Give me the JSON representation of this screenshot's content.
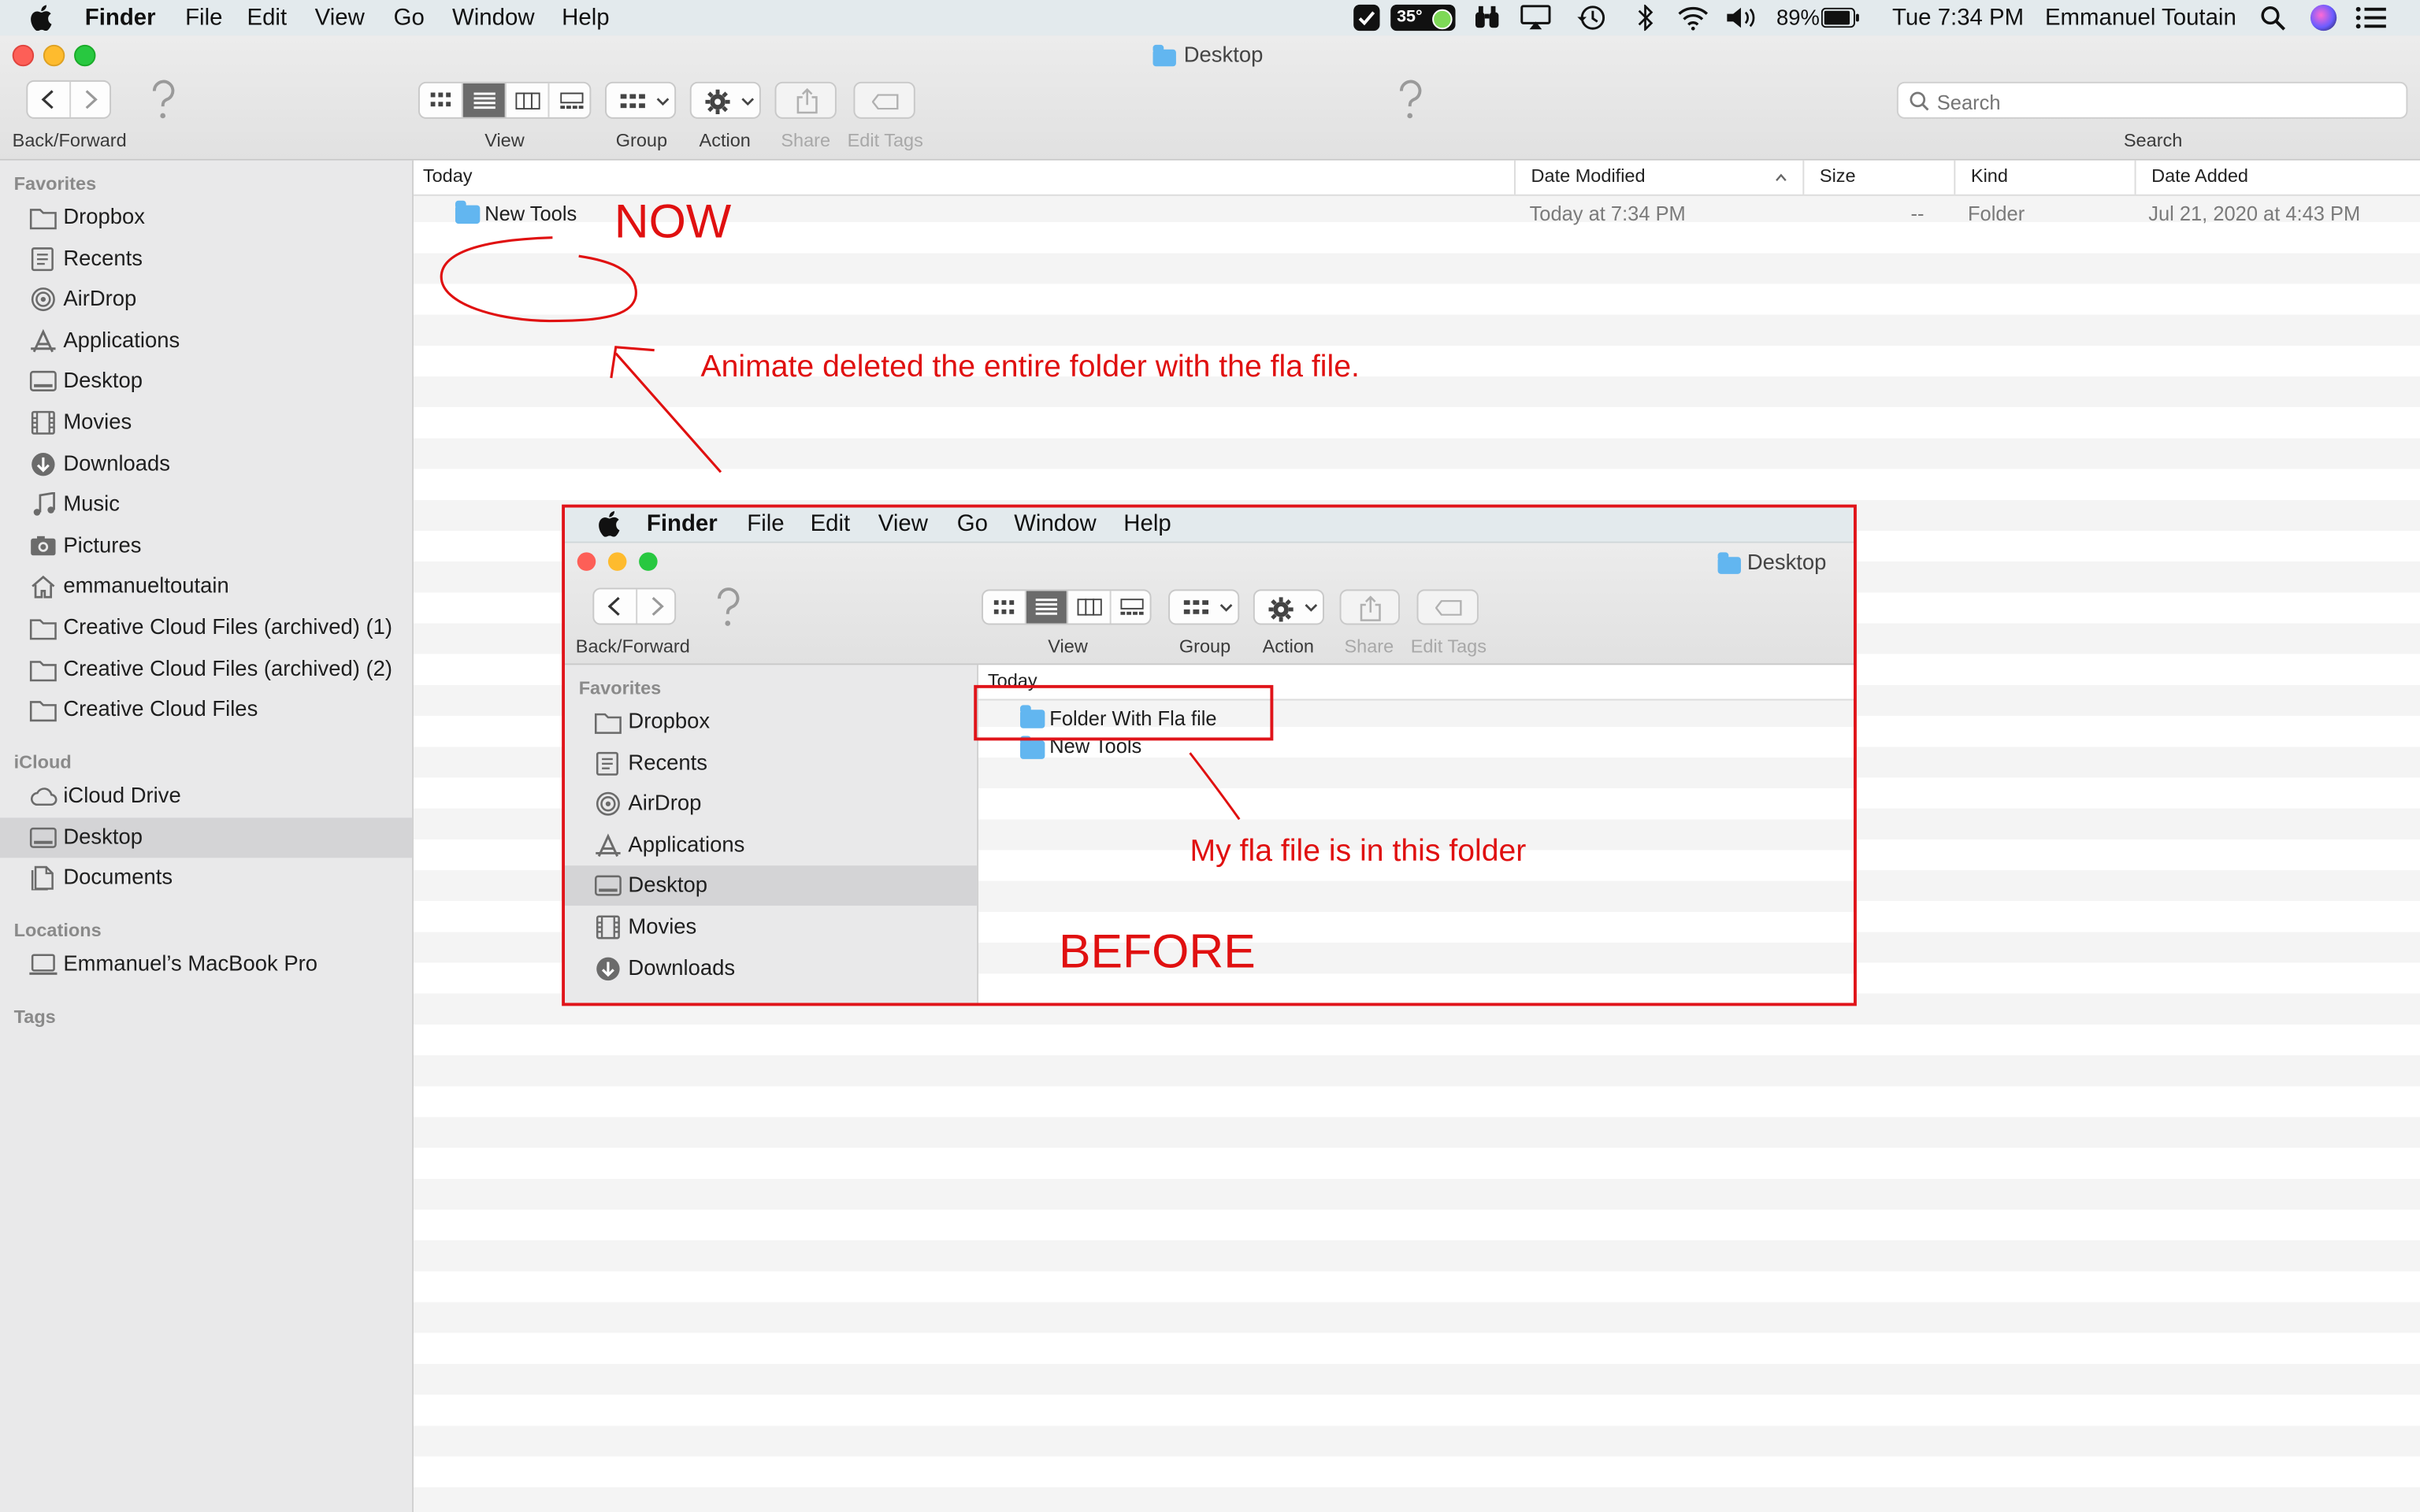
{
  "menubar": {
    "app": "Finder",
    "items": [
      "File",
      "Edit",
      "View",
      "Go",
      "Window",
      "Help"
    ],
    "status": {
      "temperature": "35°",
      "battery": "89%",
      "clock": "Tue 7:34 PM",
      "user": "Emmanuel Toutain"
    }
  },
  "window": {
    "title": "Desktop",
    "toolbar": {
      "back_forward": "Back/Forward",
      "view": "View",
      "group": "Group",
      "action": "Action",
      "share": "Share",
      "edit_tags": "Edit Tags",
      "search_placeholder": "Search",
      "search_label": "Search"
    }
  },
  "sidebar": {
    "favorites_title": "Favorites",
    "favorites": [
      {
        "label": "Dropbox",
        "icon": "folder-icon"
      },
      {
        "label": "Recents",
        "icon": "recents-icon"
      },
      {
        "label": "AirDrop",
        "icon": "airdrop-icon"
      },
      {
        "label": "Applications",
        "icon": "applications-icon"
      },
      {
        "label": "Desktop",
        "icon": "desktop-icon"
      },
      {
        "label": "Movies",
        "icon": "movies-icon"
      },
      {
        "label": "Downloads",
        "icon": "downloads-icon"
      },
      {
        "label": "Music",
        "icon": "music-icon"
      },
      {
        "label": "Pictures",
        "icon": "pictures-icon"
      },
      {
        "label": "emmanueltoutain",
        "icon": "home-icon"
      },
      {
        "label": "Creative Cloud Files (archived) (1)",
        "icon": "folder-icon"
      },
      {
        "label": "Creative Cloud Files (archived) (2)",
        "icon": "folder-icon"
      },
      {
        "label": "Creative Cloud Files",
        "icon": "folder-icon"
      }
    ],
    "icloud_title": "iCloud",
    "icloud": [
      {
        "label": "iCloud Drive",
        "icon": "cloud-icon"
      },
      {
        "label": "Desktop",
        "icon": "desktop-icon",
        "selected": true
      },
      {
        "label": "Documents",
        "icon": "documents-icon"
      }
    ],
    "locations_title": "Locations",
    "locations": [
      {
        "label": "Emmanuel’s MacBook Pro",
        "icon": "laptop-icon"
      }
    ],
    "tags_title": "Tags"
  },
  "list": {
    "group_header": "Today",
    "columns": {
      "date_modified": "Date Modified",
      "size": "Size",
      "kind": "Kind",
      "date_added": "Date Added"
    },
    "rows": [
      {
        "name": "New Tools",
        "date_modified": "Today at 7:34 PM",
        "size": "--",
        "kind": "Folder",
        "date_added": "Jul 21, 2020 at 4:43 PM"
      }
    ]
  },
  "annotations": {
    "now": "NOW",
    "deleted_note": "Animate deleted the entire folder with the fla file.",
    "fla_note": "My fla file is in this folder",
    "before": "BEFORE"
  },
  "inset": {
    "menubar_app": "Finder",
    "menubar_items": [
      "File",
      "Edit",
      "View",
      "Go",
      "Window",
      "Help"
    ],
    "title": "Desktop",
    "toolbar": {
      "back_forward": "Back/Forward",
      "view": "View",
      "group": "Group",
      "action": "Action",
      "share": "Share",
      "edit_tags": "Edit Tags"
    },
    "favorites_title": "Favorites",
    "favorites": [
      "Dropbox",
      "Recents",
      "AirDrop",
      "Applications",
      "Desktop",
      "Movies",
      "Downloads"
    ],
    "group_header": "Today",
    "rows": [
      "Folder With Fla file",
      "New Tools"
    ]
  },
  "colors": {
    "annotation_red": "#e01010",
    "folder_blue": "#62b6f0",
    "sidebar_bg": "#e9e9ea",
    "selection": "#d4d4d6"
  }
}
